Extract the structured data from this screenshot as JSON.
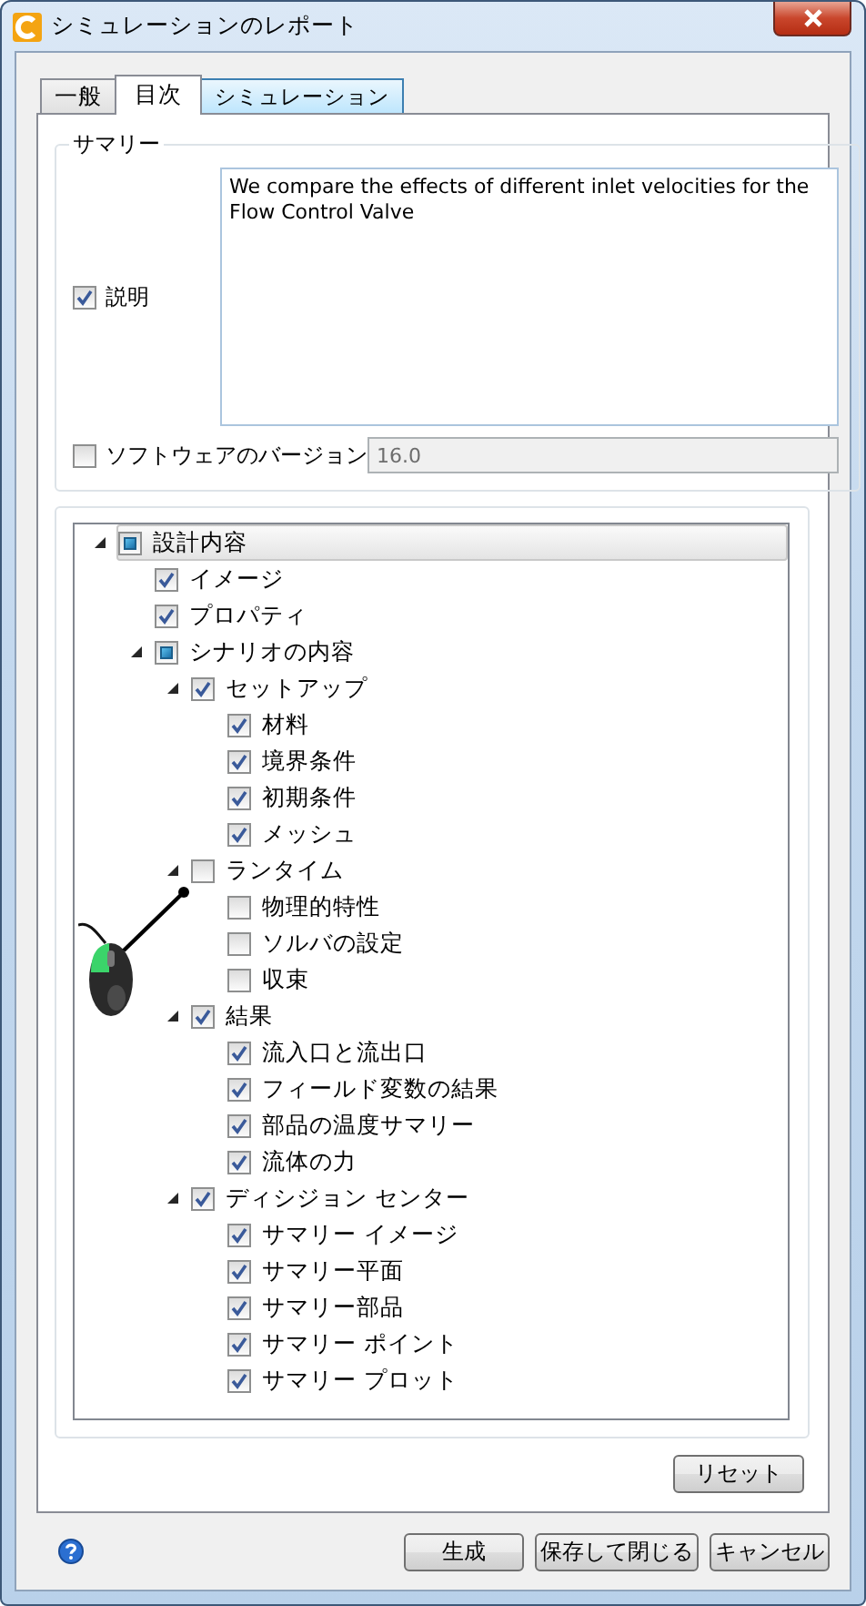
{
  "window": {
    "title": "シミュレーションのレポート"
  },
  "tabs": [
    {
      "label": "一般",
      "selected": false,
      "hovered": false
    },
    {
      "label": "目次",
      "selected": true,
      "hovered": false
    },
    {
      "label": "シミュレーション",
      "selected": false,
      "hovered": true
    }
  ],
  "summary": {
    "title": "サマリー",
    "description": {
      "label": "説明",
      "checked": true,
      "value": "We compare the effects of different inlet velocities for the Flow Control Valve"
    },
    "software_version": {
      "label": "ソフトウェアのバージョン",
      "checked": false,
      "value": "16.0",
      "disabled": true
    }
  },
  "tree": [
    {
      "label": "設計内容",
      "checked": false,
      "partial": true,
      "selected": true,
      "expanded": true,
      "children": [
        {
          "label": "イメージ",
          "checked": true,
          "selected": false
        },
        {
          "label": "プロパティ",
          "checked": true,
          "selected": false
        },
        {
          "label": "シナリオの内容",
          "checked": false,
          "partial": true,
          "selected": false,
          "expanded": true,
          "children": [
            {
              "label": "セットアップ",
              "checked": true,
              "selected": false,
              "expanded": true,
              "children": [
                {
                  "label": "材料",
                  "checked": true,
                  "selected": false
                },
                {
                  "label": "境界条件",
                  "checked": true,
                  "selected": false
                },
                {
                  "label": "初期条件",
                  "checked": true,
                  "selected": false
                },
                {
                  "label": "メッシュ",
                  "checked": true,
                  "selected": false
                }
              ]
            },
            {
              "label": "ランタイム",
              "checked": false,
              "selected": false,
              "expanded": true,
              "children": [
                {
                  "label": "物理的特性",
                  "checked": false,
                  "selected": false
                },
                {
                  "label": "ソルバの設定",
                  "checked": false,
                  "selected": false
                },
                {
                  "label": "収束",
                  "checked": false,
                  "selected": false
                }
              ]
            },
            {
              "label": "結果",
              "checked": true,
              "selected": false,
              "expanded": true,
              "children": [
                {
                  "label": "流入口と流出口",
                  "checked": true,
                  "selected": false
                },
                {
                  "label": "フィールド変数の結果",
                  "checked": true,
                  "selected": false
                },
                {
                  "label": "部品の温度サマリー",
                  "checked": true,
                  "selected": false
                },
                {
                  "label": "流体の力",
                  "checked": true,
                  "selected": false
                }
              ]
            },
            {
              "label": "ディシジョン センター",
              "checked": true,
              "selected": false,
              "expanded": true,
              "children": [
                {
                  "label": "サマリー イメージ",
                  "checked": true,
                  "selected": false
                },
                {
                  "label": "サマリー平面",
                  "checked": true,
                  "selected": false
                },
                {
                  "label": "サマリー部品",
                  "checked": true,
                  "selected": false
                },
                {
                  "label": "サマリー ポイント",
                  "checked": true,
                  "selected": false
                },
                {
                  "label": "サマリー プロット",
                  "checked": true,
                  "selected": false
                }
              ]
            }
          ]
        }
      ]
    }
  ],
  "reset_button": "リセット",
  "footer_buttons": [
    "生成",
    "保存して閉じる",
    "キャンセル"
  ]
}
